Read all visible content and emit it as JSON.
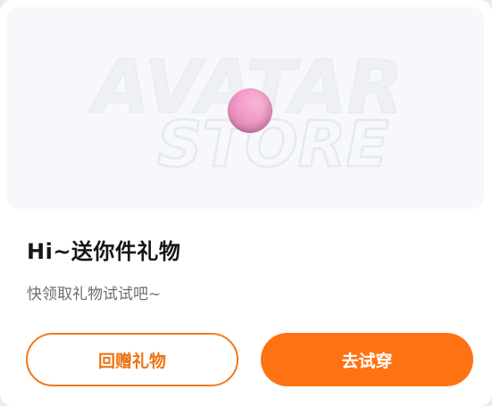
{
  "banner": {
    "watermark_line1": "AVATAR",
    "watermark_line2": "STORE",
    "image": "pink-ball-avatar-item"
  },
  "dialog": {
    "title": "Hi~送你件礼物",
    "subtitle": "快领取礼物试试吧~"
  },
  "buttons": {
    "return_gift_label": "回赠礼物",
    "try_on_label": "去试穿"
  },
  "colors": {
    "accent": "#ff7214",
    "accent_outline": "#f07a1e",
    "banner_bg": "#f7f8fb",
    "title_text": "#161616",
    "subtitle_text": "#6e6e6e"
  }
}
